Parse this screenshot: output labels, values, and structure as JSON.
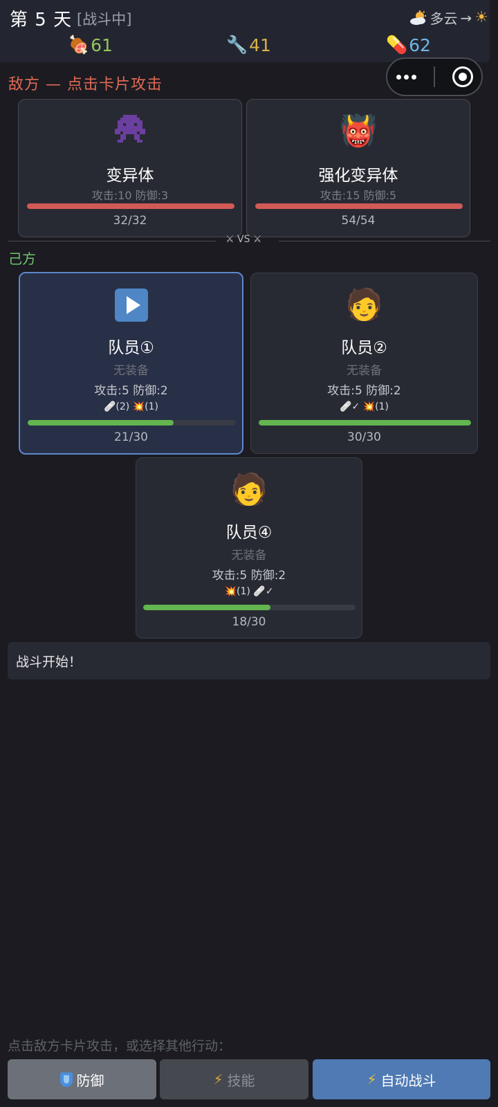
{
  "header": {
    "day": "第 5 天",
    "status": "[战斗中]",
    "weather_from_icon": "sun-behind-cloud-icon",
    "weather_text": "多云",
    "weather_arrow": "→",
    "weather_to_icon": "sun-icon",
    "weather_to_glyph": "☀"
  },
  "resources": {
    "food": {
      "icon": "meat-icon",
      "glyph": "🍖",
      "value": "61"
    },
    "tools": {
      "icon": "wrench-icon",
      "glyph": "🔧",
      "value": "41"
    },
    "medicine": {
      "icon": "pill-icon",
      "glyph": "💊",
      "value": "62"
    }
  },
  "enemy_section": {
    "title": "敌方 — 点击卡片攻击",
    "enemies": [
      {
        "icon": "pixel-alien-icon",
        "name": "变异体",
        "stats": "攻击:10  防御:3",
        "hp_text": "32/32",
        "hp": 32,
        "hp_max": 32
      },
      {
        "icon": "ogre-icon",
        "glyph": "👹",
        "name": "强化变异体",
        "stats": "攻击:15  防御:5",
        "hp_text": "54/54",
        "hp": 54,
        "hp_max": 54
      }
    ]
  },
  "vs_text": "⚔ VS ⚔",
  "ally_section": {
    "title": "己方",
    "members": [
      {
        "icon": "play-icon",
        "name": "队员①",
        "equip": "无装备",
        "stats": "攻击:5  防御:2",
        "effects": "🩹(2) 💥(1)",
        "hp_text": "21/30",
        "hp": 21,
        "hp_max": 30,
        "selected": true
      },
      {
        "icon": "person-icon",
        "glyph": "🧑",
        "name": "队员②",
        "equip": "无装备",
        "stats": "攻击:5  防御:2",
        "effects": "🩹✓ 💥(1)",
        "hp_text": "30/30",
        "hp": 30,
        "hp_max": 30
      },
      {
        "icon": "person-icon",
        "glyph": "🧑",
        "name": "队员④",
        "equip": "无装备",
        "stats": "攻击:5  防御:2",
        "effects": "💥(1) 🩹✓",
        "hp_text": "18/30",
        "hp": 18,
        "hp_max": 30
      }
    ]
  },
  "log": {
    "text": "战斗开始！"
  },
  "actions": {
    "hint": "点击敌方卡片攻击，或选择其他行动：",
    "defend_label": "防御",
    "skill_label": "技能",
    "skill_glyph": "⚡",
    "auto_label": "自动战斗",
    "auto_glyph": "⚡"
  },
  "colors": {
    "enemy_title": "#e06a55",
    "ally_title": "#6fc46c",
    "hp_enemy": "#d25a56",
    "hp_ally": "#62b54f",
    "selected_border": "#5f88cc",
    "auto_button": "#4f7ab3"
  }
}
